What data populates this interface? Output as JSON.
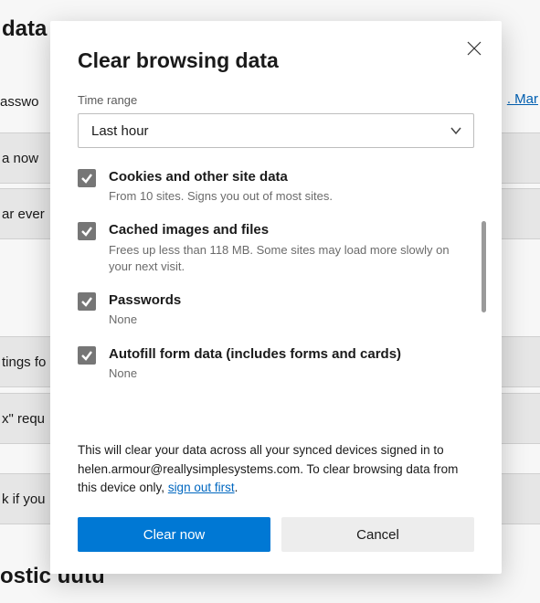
{
  "background": {
    "heading_fragment": "data",
    "passwords_fragment": "asswo",
    "link_fragment": ". Mar",
    "rows": [
      "a now",
      "ar ever",
      "tings fo",
      "x\" requ",
      "k if you"
    ],
    "bottom_heading_fragment": "ostic uutu"
  },
  "modal": {
    "title": "Clear browsing data",
    "time_range_label": "Time range",
    "time_range_value": "Last hour",
    "options": [
      {
        "title": "Cookies and other site data",
        "desc": "From 10 sites. Signs you out of most sites.",
        "checked": true
      },
      {
        "title": "Cached images and files",
        "desc": "Frees up less than 118 MB. Some sites may load more slowly on your next visit.",
        "checked": true
      },
      {
        "title": "Passwords",
        "desc": "None",
        "checked": true
      },
      {
        "title": "Autofill form data (includes forms and cards)",
        "desc": "None",
        "checked": true
      }
    ],
    "footer": {
      "text_before": "This will clear your data across all your synced devices signed in to helen.armour@reallysimplesystems.com. To clear browsing data from this device only, ",
      "link": "sign out first",
      "text_after": "."
    },
    "clear_label": "Clear now",
    "cancel_label": "Cancel"
  }
}
